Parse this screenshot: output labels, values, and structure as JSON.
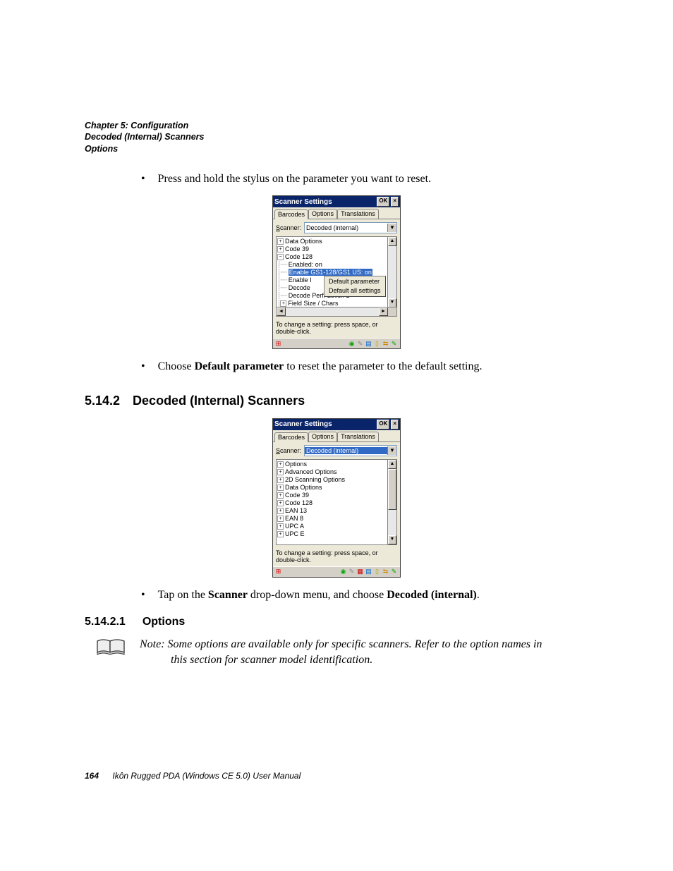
{
  "header": {
    "line1": "Chapter 5: Configuration",
    "line2": "Decoded (Internal) Scanners",
    "line3": "Options"
  },
  "bullet1": "Press and hold the stylus on the parameter you want to reset.",
  "bullet2_pre": "Choose ",
  "bullet2_bold": "Default parameter",
  "bullet2_post": " to reset the parameter to the default setting.",
  "section": {
    "num": "5.14.2",
    "title": "Decoded (Internal) Scanners"
  },
  "bullet3_pre": "Tap on the ",
  "bullet3_bold1": "Scanner",
  "bullet3_mid": " drop-down menu, and choose ",
  "bullet3_bold2": "Decoded (internal)",
  "bullet3_post": ".",
  "subsection": {
    "num": "5.14.2.1",
    "title": "Options"
  },
  "note_label": "Note:",
  "note_l1": "Some options are available only for specific scanners. Refer to the option names in",
  "note_l2": "this section for scanner model identification.",
  "footer": {
    "page": "164",
    "text": "Ikôn Rugged PDA (Windows CE 5.0) User Manual"
  },
  "win": {
    "title": "Scanner Settings",
    "ok": "OK",
    "close": "×",
    "tabs": {
      "barcodes": "Barcodes",
      "options": "Options",
      "translations": "Translations"
    },
    "scanner_label": "Scanner:",
    "scanner_label_u": "S",
    "scanner_label_rest": "canner:",
    "scanner_value": "Decoded (internal)",
    "hint": "To change a setting: press space, or double-click."
  },
  "tree1": {
    "r0": "Data Options",
    "r1": "Code 39",
    "r2": "Code 128",
    "r3": "Enabled: on",
    "r4": "Enable GS1-128/GS1 US: on",
    "r5_a": "Enable I",
    "r6_a": "Decode",
    "r7": "Decode Perf. Level: 1",
    "r8": "Field Size / Chars",
    "ctx1": "Default parameter",
    "ctx2": "Default all settings"
  },
  "tree2": {
    "r0": "Options",
    "r1": "Advanced Options",
    "r2": "2D Scanning Options",
    "r3": "Data Options",
    "r4": "Code 39",
    "r5": "Code 128",
    "r6": "EAN 13",
    "r7": "EAN 8",
    "r8": "UPC A",
    "r9": "UPC E"
  }
}
